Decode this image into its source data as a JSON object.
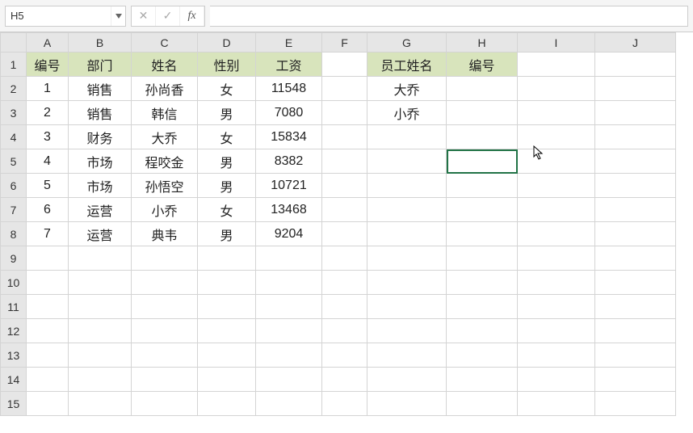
{
  "nameBox": "H5",
  "formula": "",
  "columns": [
    "A",
    "B",
    "C",
    "D",
    "E",
    "F",
    "G",
    "H",
    "I",
    "J"
  ],
  "rows": [
    "1",
    "2",
    "3",
    "4",
    "5",
    "6",
    "7",
    "8",
    "9",
    "10",
    "11",
    "12",
    "13",
    "14",
    "15"
  ],
  "selectedCell": "H5",
  "headersMain": {
    "A": "编号",
    "B": "部门",
    "C": "姓名",
    "D": "性别",
    "E": "工资"
  },
  "headersSide": {
    "G": "员工姓名",
    "H": "编号"
  },
  "dataMain": [
    {
      "A": "1",
      "B": "销售",
      "C": "孙尚香",
      "D": "女",
      "E": "11548"
    },
    {
      "A": "2",
      "B": "销售",
      "C": "韩信",
      "D": "男",
      "E": "7080"
    },
    {
      "A": "3",
      "B": "财务",
      "C": "大乔",
      "D": "女",
      "E": "15834"
    },
    {
      "A": "4",
      "B": "市场",
      "C": "程咬金",
      "D": "男",
      "E": "8382"
    },
    {
      "A": "5",
      "B": "市场",
      "C": "孙悟空",
      "D": "男",
      "E": "10721"
    },
    {
      "A": "6",
      "B": "运营",
      "C": "小乔",
      "D": "女",
      "E": "13468"
    },
    {
      "A": "7",
      "B": "运营",
      "C": "典韦",
      "D": "男",
      "E": "9204"
    }
  ],
  "dataSide": [
    {
      "G": "大乔"
    },
    {
      "G": "小乔"
    }
  ],
  "chart_data": {
    "type": "table",
    "title": "",
    "columns": [
      "编号",
      "部门",
      "姓名",
      "性别",
      "工资"
    ],
    "rows": [
      [
        1,
        "销售",
        "孙尚香",
        "女",
        11548
      ],
      [
        2,
        "销售",
        "韩信",
        "男",
        7080
      ],
      [
        3,
        "财务",
        "大乔",
        "女",
        15834
      ],
      [
        4,
        "市场",
        "程咬金",
        "男",
        8382
      ],
      [
        5,
        "市场",
        "孙悟空",
        "男",
        10721
      ],
      [
        6,
        "运营",
        "小乔",
        "女",
        13468
      ],
      [
        7,
        "运营",
        "典韦",
        "男",
        9204
      ]
    ],
    "lookup": {
      "columns": [
        "员工姓名",
        "编号"
      ],
      "rows": [
        [
          "大乔",
          ""
        ],
        [
          "小乔",
          ""
        ]
      ]
    }
  }
}
